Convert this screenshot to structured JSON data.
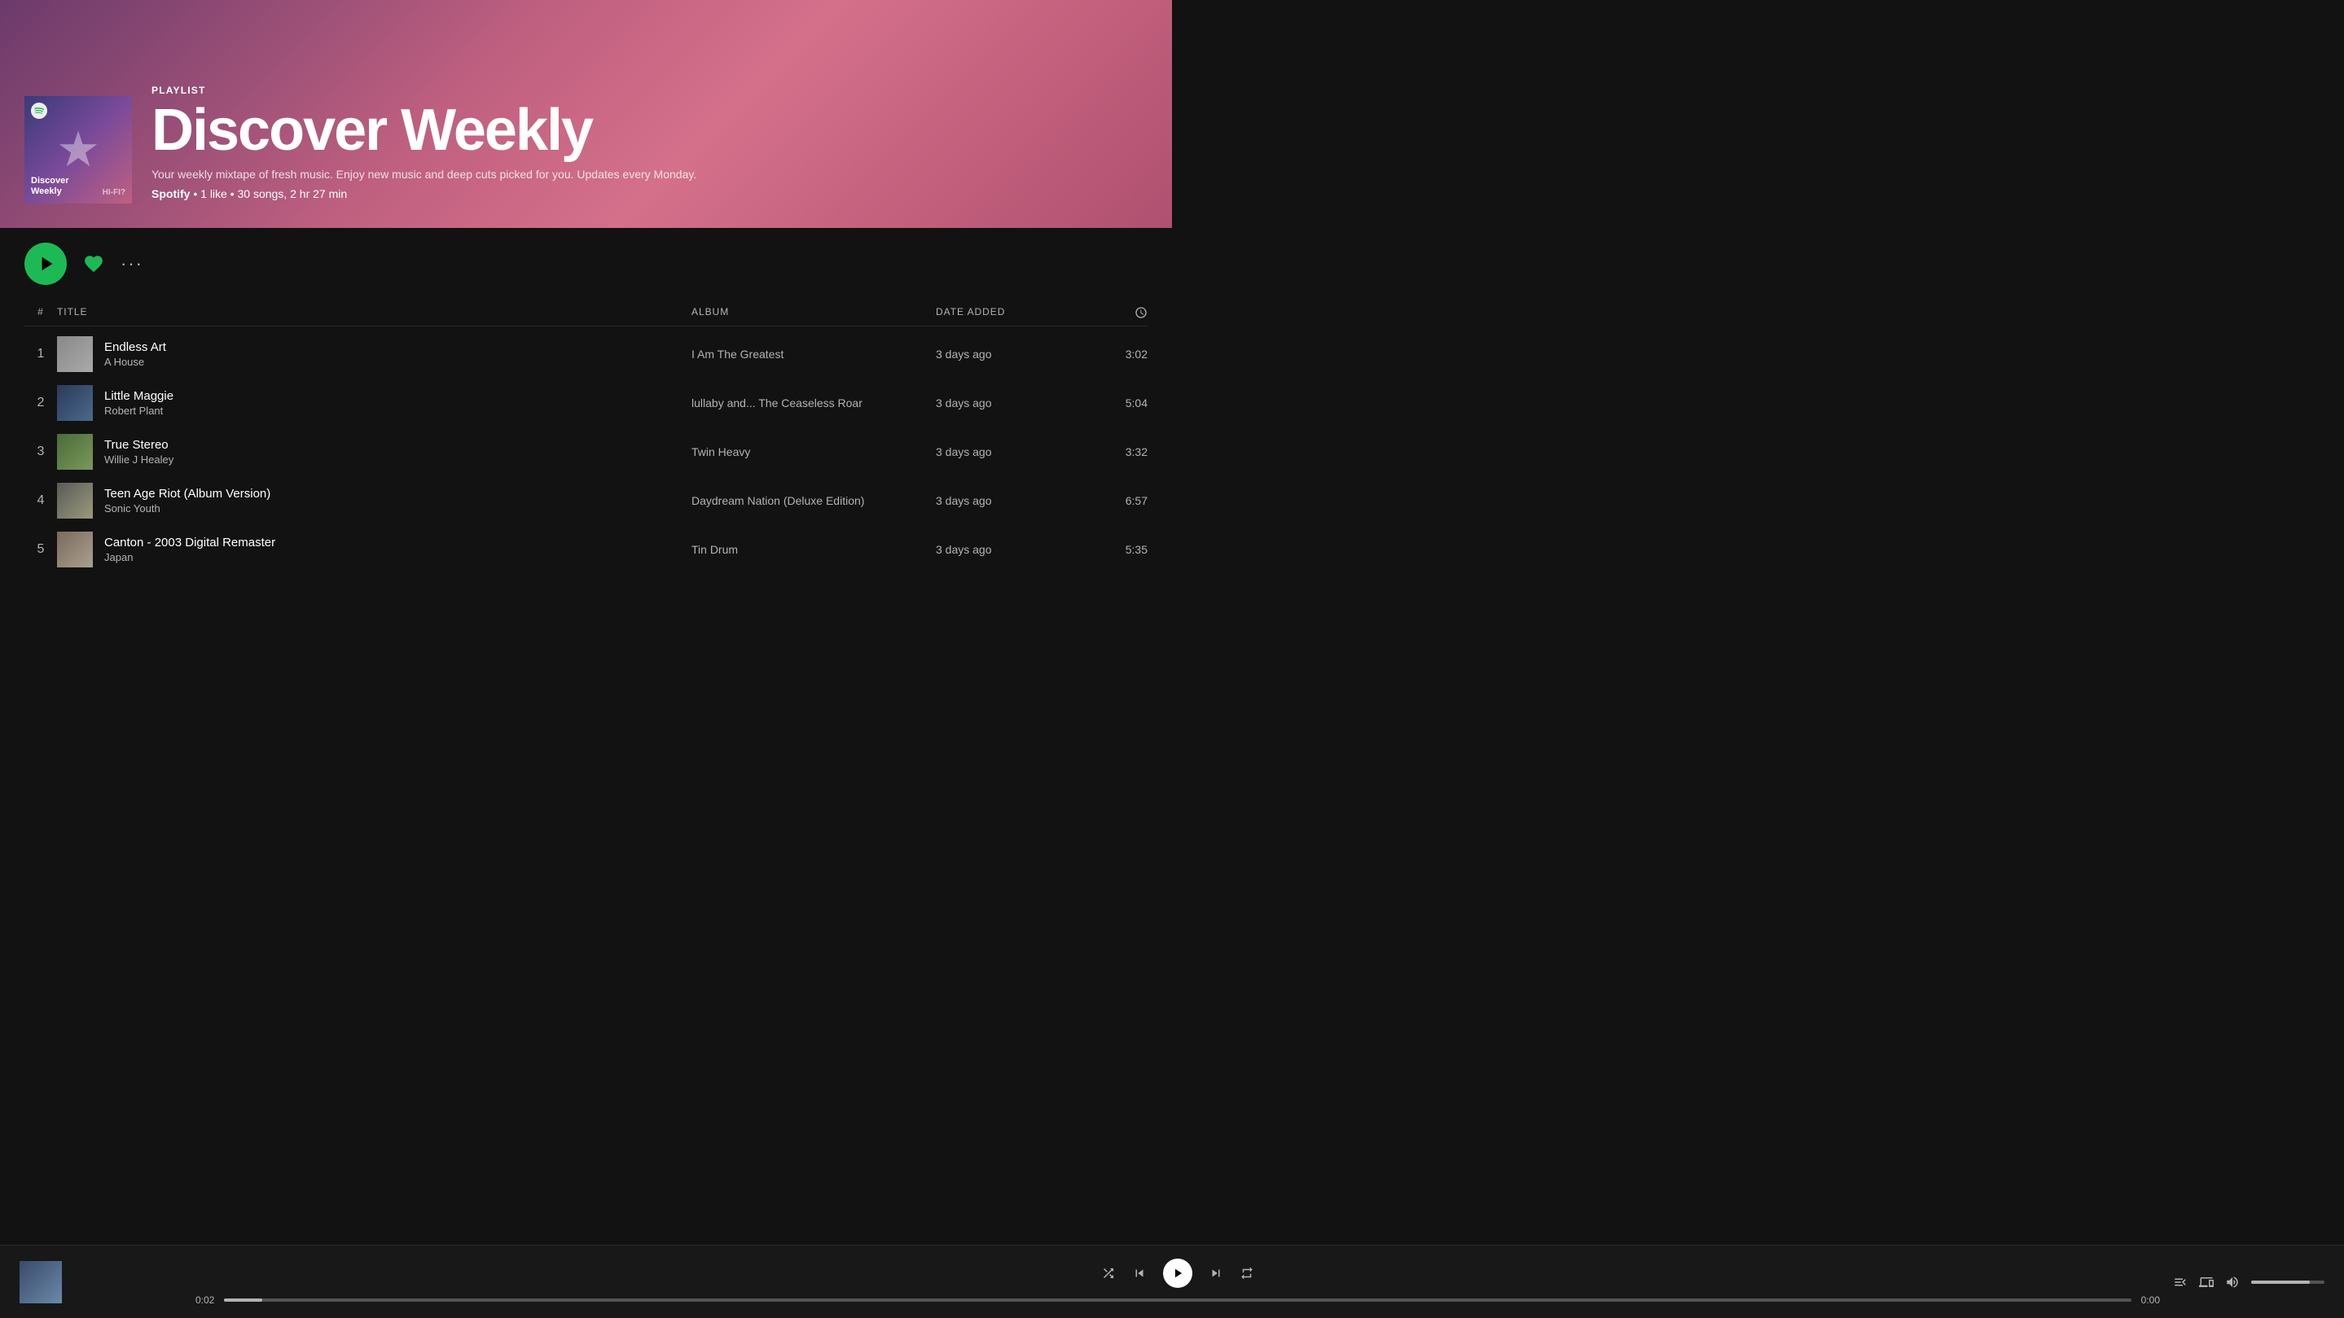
{
  "hero": {
    "type_label": "PLAYLIST",
    "title": "Discover Weekly",
    "description": "Your weekly mixtape of fresh music. Enjoy new music and deep cuts picked for you. Updates every Monday.",
    "creator": "Spotify",
    "meta": "1 like • 30 songs, 2 hr 27 min"
  },
  "controls": {
    "play_label": "Play",
    "like_label": "Like",
    "more_label": "More options"
  },
  "table": {
    "col_num": "#",
    "col_title": "TITLE",
    "col_album": "ALBUM",
    "col_date": "DATE ADDED",
    "col_duration": "duration-clock"
  },
  "tracks": [
    {
      "num": "1",
      "title": "Endless Art",
      "artist": "A House",
      "album": "I Am The Greatest",
      "date_added": "3 days ago",
      "duration": "3:02",
      "thumb_class": "track-thumb-1"
    },
    {
      "num": "2",
      "title": "Little Maggie",
      "artist": "Robert Plant",
      "album": "lullaby and... The Ceaseless Roar",
      "date_added": "3 days ago",
      "duration": "5:04",
      "thumb_class": "track-thumb-2"
    },
    {
      "num": "3",
      "title": "True Stereo",
      "artist": "Willie J Healey",
      "album": "Twin Heavy",
      "date_added": "3 days ago",
      "duration": "3:32",
      "thumb_class": "track-thumb-3"
    },
    {
      "num": "4",
      "title": "Teen Age Riot (Album Version)",
      "artist": "Sonic Youth",
      "album": "Daydream Nation (Deluxe Edition)",
      "date_added": "3 days ago",
      "duration": "6:57",
      "thumb_class": "track-thumb-4"
    },
    {
      "num": "5",
      "title": "Canton - 2003 Digital Remaster",
      "artist": "Japan",
      "album": "Tin Drum",
      "date_added": "3 days ago",
      "duration": "5:35",
      "thumb_class": "track-thumb-5"
    }
  ],
  "now_playing": {
    "current_time": "0:02",
    "total_time": "0:00",
    "progress_percent": 2
  }
}
